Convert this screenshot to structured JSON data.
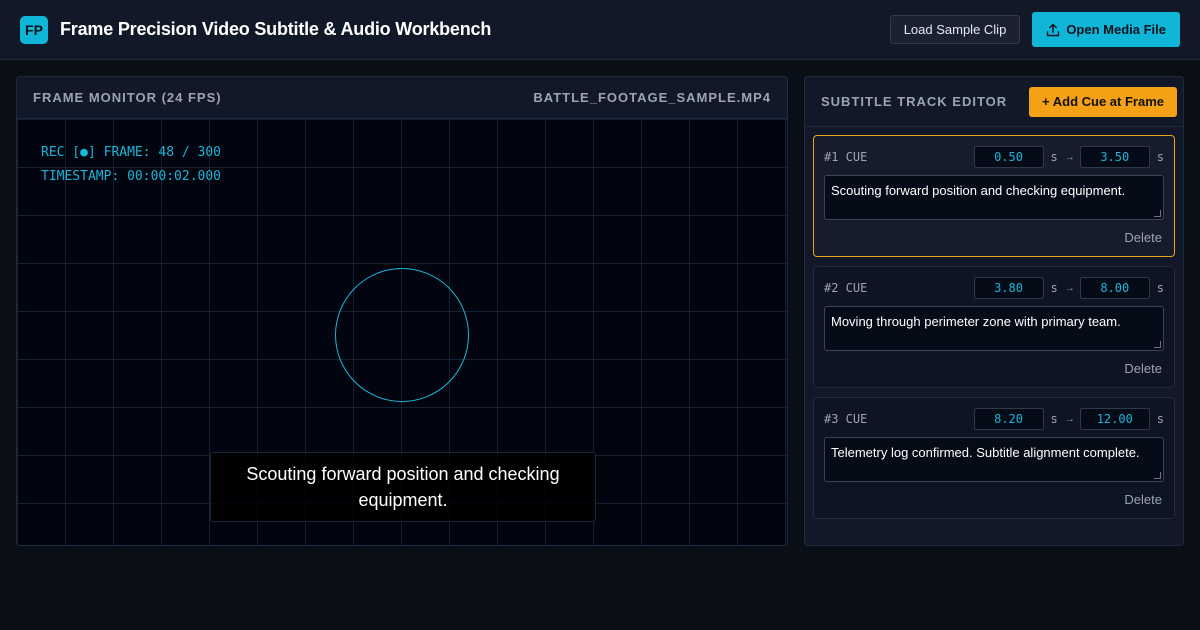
{
  "header": {
    "logo": "FP",
    "title": "Frame Precision Video Subtitle & Audio Workbench",
    "load_sample_label": "Load Sample Clip",
    "open_media_label": "Open Media File",
    "open_media_icon": "upload-icon"
  },
  "monitor": {
    "heading": "FRAME MONITOR (24 FPS)",
    "file_name": "BATTLE_FOOTAGE_SAMPLE.MP4",
    "hud_frame": "REC [●] FRAME: 48 / 300",
    "hud_timestamp": "TIMESTAMP: 00:00:02.000",
    "subtitle": "Scouting forward position and checking equipment."
  },
  "editor": {
    "heading": "SUBTITLE TRACK EDITOR",
    "add_cue_label": "+ Add Cue at Frame",
    "cues": [
      {
        "label": "#1 CUE",
        "start": "0.50",
        "end": "3.50",
        "unit": "s",
        "arrow": "→",
        "text": "Scouting forward position and checking equipment.",
        "delete_label": "Delete",
        "active": true
      },
      {
        "label": "#2 CUE",
        "start": "3.80",
        "end": "8.00",
        "unit": "s",
        "arrow": "→",
        "text": "Moving through perimeter zone with primary team.",
        "delete_label": "Delete",
        "active": false
      },
      {
        "label": "#3 CUE",
        "start": "8.20",
        "end": "12.00",
        "unit": "s",
        "arrow": "→",
        "text": "Telemetry log confirmed. Subtitle alignment complete.",
        "delete_label": "Delete",
        "active": false
      }
    ]
  },
  "colors": {
    "accent": "#0fb6d8",
    "active_cue_border": "#f5a116",
    "add_button": "#f5a116",
    "background": "#0a0e17"
  }
}
